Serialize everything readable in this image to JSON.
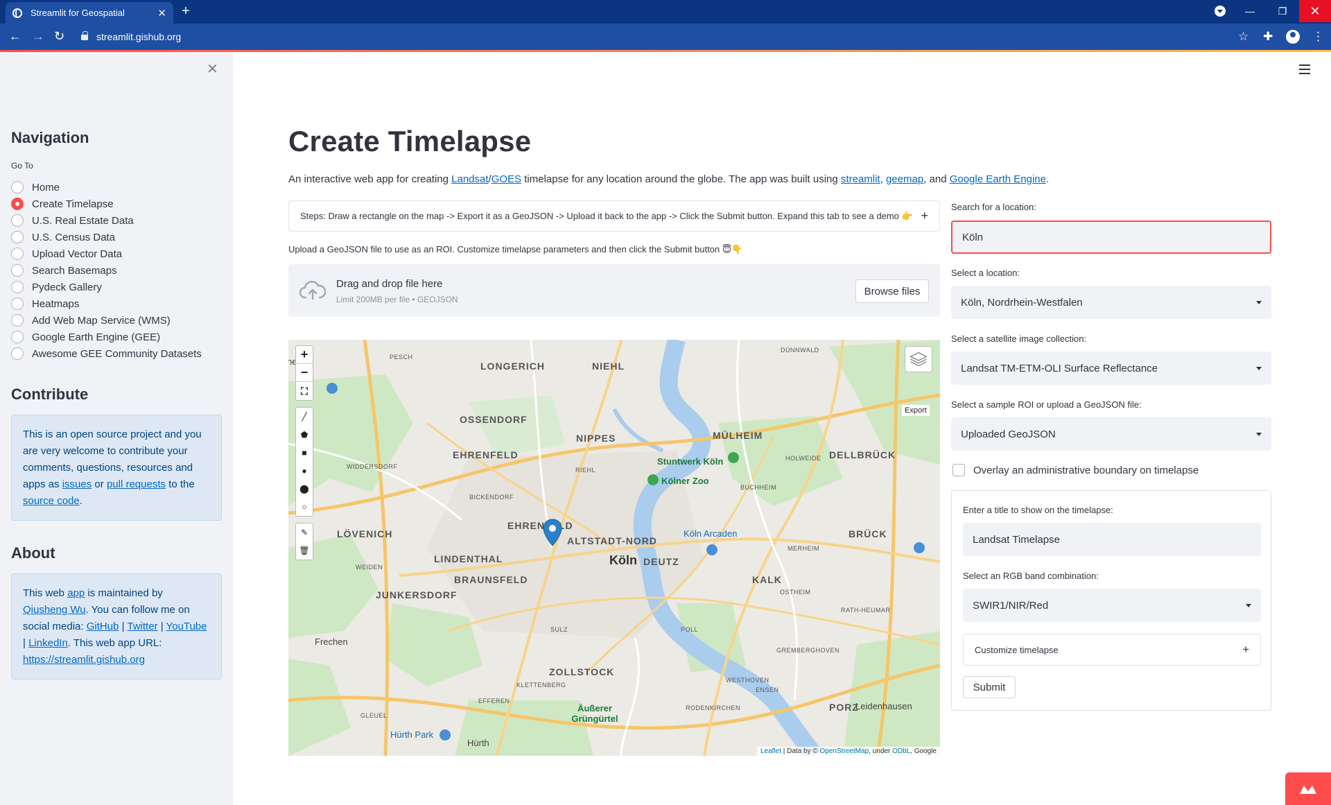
{
  "browser": {
    "tab_title": "Streamlit for Geospatial",
    "url": "streamlit.gishub.org"
  },
  "sidebar": {
    "nav_title": "Navigation",
    "goto_label": "Go To",
    "items": [
      {
        "label": "Home",
        "selected": false
      },
      {
        "label": "Create Timelapse",
        "selected": true
      },
      {
        "label": "U.S. Real Estate Data",
        "selected": false
      },
      {
        "label": "U.S. Census Data",
        "selected": false
      },
      {
        "label": "Upload Vector Data",
        "selected": false
      },
      {
        "label": "Search Basemaps",
        "selected": false
      },
      {
        "label": "Pydeck Gallery",
        "selected": false
      },
      {
        "label": "Heatmaps",
        "selected": false
      },
      {
        "label": "Add Web Map Service (WMS)",
        "selected": false
      },
      {
        "label": "Google Earth Engine (GEE)",
        "selected": false
      },
      {
        "label": "Awesome GEE Community Datasets",
        "selected": false
      }
    ],
    "contribute_title": "Contribute",
    "contribute": {
      "t1": "This is an open source project and you are very welcome to contribute your comments, questions, resources and apps as ",
      "issues": "issues",
      "t2": " or ",
      "pull_requests": "pull requests",
      "t3": " to the ",
      "source_code": "source code",
      "t4": "."
    },
    "about_title": "About",
    "about": {
      "t1": "This web ",
      "app": "app",
      "t2": " is maintained by ",
      "author": "Qiusheng Wu",
      "t3": ". You can follow me on social media: ",
      "github": "GitHub",
      "sep": " | ",
      "twitter": "Twitter",
      "youtube": "YouTube",
      "linkedin": "LinkedIn",
      "t4": ". This web app URL: ",
      "url": "https://streamlit.gishub.org"
    }
  },
  "main": {
    "title": "Create Timelapse",
    "intro": {
      "t1": "An interactive web app for creating ",
      "landsat": "Landsat",
      "slash": "/",
      "goes": "GOES",
      "t2": " timelapse for any location around the globe. The app was built using ",
      "streamlit": "streamlit",
      "comma": ", ",
      "geemap": "geemap",
      "t3": ", and ",
      "gee": "Google Earth Engine",
      "t4": "."
    },
    "steps": "Steps: Draw a rectangle on the map -> Export it as a GeoJSON -> Upload it back to the app -> Click the Submit button. Expand this tab to see a demo 👉",
    "upload_note": "Upload a GeoJSON file to use as an ROI. Customize timelapse parameters and then click the Submit button 😇👇",
    "dropzone": {
      "main": "Drag and drop file here",
      "sub": "Limit 200MB per file • GEOJSON",
      "browse": "Browse files"
    }
  },
  "map": {
    "export_label": "Export",
    "attribution": {
      "leaflet": "Leaflet",
      "t1": " | Data by © ",
      "osm": "OpenStreetMap",
      "t2": ", under ",
      "odbl": "ODbL",
      "t3": ", Google"
    },
    "labels": {
      "longerich": "LONGERICH",
      "niehl": "NIEHL",
      "ossendorf": "OSSENDORF",
      "nippes": "NIPPES",
      "muelheim": "MÜLHEIM",
      "ehrenfeld": "EHRENFELD",
      "dellbrueck": "DELLBRÜCK",
      "loevenich": "LÖVENICH",
      "ehrenfeld2": "EHRENFELD",
      "altstadt": "ALTSTADT-NORD",
      "bruck": "BRÜCK",
      "lindenthal": "LINDENTHAL",
      "koeln": "Köln",
      "deutz": "DEUTZ",
      "braunsfeld": "BRAUNSFELD",
      "kalk": "KALK",
      "junkersdorf": "JUNKERSDORF",
      "zollstock": "ZOLLSTOCK",
      "porz": "PORZ",
      "frechen": "Frechen",
      "huerth": "Hürth",
      "stuntwerk": "Stuntwerk Köln",
      "zoo": "Kölner Zoo",
      "arcaden": "Köln Arcaden",
      "huerthpark": "Hürth Park",
      "aeusserer": "Äußerer Grüngürtel",
      "leidenhausen": "Leidenhausen",
      "heim": "heim",
      "pesch": "PESCH",
      "bickendorf": "BICKENDORF",
      "widdersdorf": "WIDDERSDORF",
      "weiden": "WEIDEN",
      "sulz": "SULZ",
      "efferen": "EFFEREN",
      "gleuel": "GLEUEL",
      "klettenberg": "KLETTENBERG",
      "rodenkirchen": "RODENKIRCHEN",
      "westhoven": "WESTHOVEN",
      "ensen": "ENSEN",
      "poll": "POLL",
      "grembergh": "GREMBERGHOVEN",
      "ostheim": "OSTHEIM",
      "rathheumar": "RATH-HEUMAR",
      "merheim": "MERHEIM",
      "holweide": "HOLWEIDE",
      "buchheim": "BUCHHEIM",
      "duennwald": "DÜNNWALD",
      "riehl": "RIEHL"
    }
  },
  "right": {
    "search_label": "Search for a location:",
    "search_value": "Köln",
    "location_label": "Select a location:",
    "location_value": "Köln, Nordrhein-Westfalen",
    "collection_label": "Select a satellite image collection:",
    "collection_value": "Landsat TM-ETM-OLI Surface Reflectance",
    "roi_label": "Select a sample ROI or upload a GeoJSON file:",
    "roi_value": "Uploaded GeoJSON",
    "overlay_label": "Overlay an administrative boundary on timelapse",
    "title_label": "Enter a title to show on the timelapse:",
    "title_value": "Landsat Timelapse",
    "rgb_label": "Select an RGB band combination:",
    "rgb_value": "SWIR1/NIR/Red",
    "customize_label": "Customize timelapse",
    "submit_label": "Submit"
  },
  "colors": {
    "accent": "#ff4b4b",
    "link": "#0068c9",
    "chrome": "#0b3580"
  }
}
